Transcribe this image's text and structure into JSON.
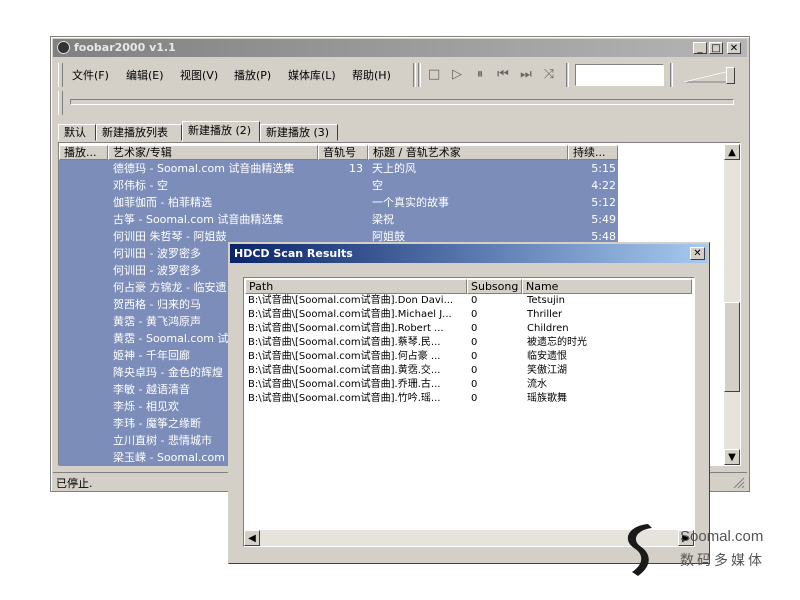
{
  "app": {
    "title": "foobar2000 v1.1",
    "status": "已停止.",
    "window_controls": {
      "minimize": "_",
      "maximize": "□",
      "close": "✕"
    }
  },
  "menu": [
    "文件(F)",
    "编辑(E)",
    "视图(V)",
    "播放(P)",
    "媒体库(L)",
    "帮助(H)"
  ],
  "toolbar_icons": [
    "stop-icon",
    "play-icon",
    "pause-icon",
    "previous-icon",
    "next-icon",
    "random-icon"
  ],
  "tabs": [
    "默认",
    "新建播放列表",
    "新建播放 (2)",
    "新建播放 (3)"
  ],
  "active_tab": 2,
  "playlist": {
    "columns": [
      "播放...",
      "艺术家/专辑",
      "音轨号",
      "标题 / 音轨艺术家",
      "持续..."
    ],
    "rows": [
      {
        "artist_album": "德德玛 - Soomal.com 试音曲精选集",
        "track": "13",
        "title": "天上的风",
        "duration": "5:15"
      },
      {
        "artist_album": "邓伟标 - 空",
        "track": "",
        "title": "空",
        "duration": "4:22"
      },
      {
        "artist_album": "伽菲伽而 - 柏菲精选",
        "track": "",
        "title": "一个真实的故事",
        "duration": "5:12"
      },
      {
        "artist_album": "古筝 - Soomal.com 试音曲精选集",
        "track": "",
        "title": "梁祝",
        "duration": "5:49"
      },
      {
        "artist_album": "何训田 朱哲琴 - 阿姐鼓",
        "track": "",
        "title": "阿姐鼓",
        "duration": "5:48"
      },
      {
        "artist_album": "何训田 - 波罗密多",
        "track": "",
        "title": "",
        "duration": ""
      },
      {
        "artist_album": "何训田 - 波罗密多",
        "track": "",
        "title": "",
        "duration": ""
      },
      {
        "artist_album": "何占豪 方锦龙 - 临安遗",
        "track": "",
        "title": "",
        "duration": ""
      },
      {
        "artist_album": "贺西格 - 归来的马",
        "track": "",
        "title": "",
        "duration": ""
      },
      {
        "artist_album": "黄霑 - 黄飞鸿原声",
        "track": "",
        "title": "",
        "duration": ""
      },
      {
        "artist_album": "黄霑 - Soomal.com 试音",
        "track": "",
        "title": "",
        "duration": ""
      },
      {
        "artist_album": "姬神 - 千年回廊",
        "track": "",
        "title": "",
        "duration": ""
      },
      {
        "artist_album": "降央卓玛 - 金色的辉煌",
        "track": "",
        "title": "",
        "duration": ""
      },
      {
        "artist_album": "李敏 - 越语清音",
        "track": "",
        "title": "",
        "duration": ""
      },
      {
        "artist_album": "李烁 - 相见欢",
        "track": "",
        "title": "",
        "duration": ""
      },
      {
        "artist_album": "李玮 - 魔筝之缘断",
        "track": "",
        "title": "",
        "duration": ""
      },
      {
        "artist_album": "立川直树 - 悲情城市",
        "track": "",
        "title": "",
        "duration": ""
      },
      {
        "artist_album": "梁玉嵘 - Soomal.com 试",
        "track": "",
        "title": "",
        "duration": ""
      }
    ]
  },
  "dialog": {
    "title": "HDCD Scan Results",
    "close": "✕",
    "columns": [
      "Path",
      "Subsong",
      "Name"
    ],
    "rows": [
      {
        "path": "B:\\试音曲\\[Soomal.com试音曲].Don Davi...",
        "subsong": "0",
        "name": "Tetsujin"
      },
      {
        "path": "B:\\试音曲\\[Soomal.com试音曲].Michael J...",
        "subsong": "0",
        "name": "Thriller"
      },
      {
        "path": "B:\\试音曲\\[Soomal.com试音曲].Robert ...",
        "subsong": "0",
        "name": "Children"
      },
      {
        "path": "B:\\试音曲\\[Soomal.com试音曲].蔡琴.民...",
        "subsong": "0",
        "name": "被遗忘的时光"
      },
      {
        "path": "B:\\试音曲\\[Soomal.com试音曲].何占豪 ...",
        "subsong": "0",
        "name": "临安遗恨"
      },
      {
        "path": "B:\\试音曲\\[Soomal.com试音曲].黄霑.交...",
        "subsong": "0",
        "name": "笑傲江湖"
      },
      {
        "path": "B:\\试音曲\\[Soomal.com试音曲].乔珊.古...",
        "subsong": "0",
        "name": "流水"
      },
      {
        "path": "B:\\试音曲\\[Soomal.com试音曲].竹吟.瑶...",
        "subsong": "0",
        "name": "瑶族歌舞"
      }
    ]
  },
  "watermark": {
    "site": "Soomal.com",
    "tagline": "数码多媒体"
  },
  "colors": {
    "selection": "#7b8db8",
    "dialog_title": "#0a246a",
    "inactive_title": "#808080"
  }
}
